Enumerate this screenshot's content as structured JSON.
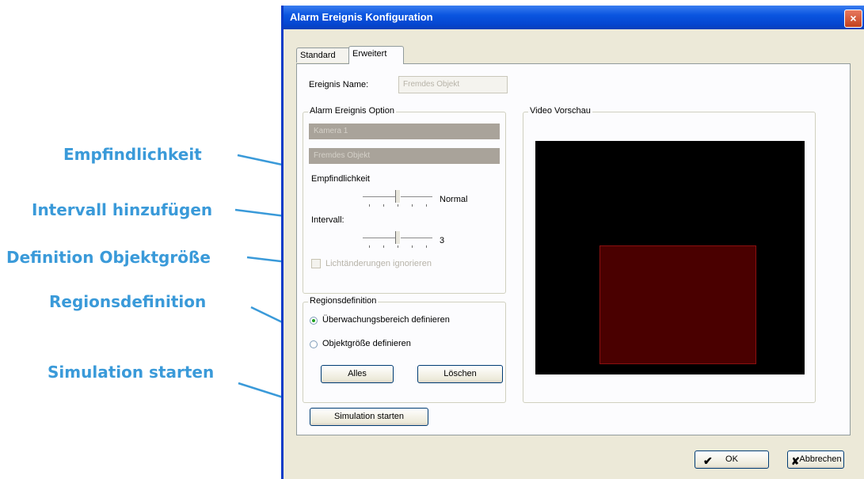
{
  "annotations": {
    "empfindlichkeit": "Empfindlichkeit",
    "intervall": "Intervall hinzufügen",
    "objektgroesse": "Definition Objektgröße",
    "regionsdefinition": "Regionsdefinition",
    "simulation": "Simulation starten",
    "color": "#3a9ad9"
  },
  "window": {
    "title": "Alarm Ereignis Konfiguration",
    "close_label": "×"
  },
  "tabs": [
    {
      "label": "Standard",
      "active": false
    },
    {
      "label": "Erweitert",
      "active": true
    }
  ],
  "event_name": {
    "label": "Ereignis Name:",
    "value": "Fremdes Objekt"
  },
  "alarm_option": {
    "group_label": "Alarm Ereignis Option",
    "camera": "Kamera 1",
    "type": "Fremdes Objekt",
    "sensitivity_label": "Empfindlichkeit",
    "sensitivity_value": "Normal",
    "sensitivity_level": 0.5,
    "interval_label": "Intervall:",
    "interval_value": "3",
    "interval_level": 0.5,
    "ignore_light_label": "Lichtänderungen ignorieren"
  },
  "region": {
    "group_label": "Regionsdefinition",
    "option_monitor": "Überwachungsbereich definieren",
    "option_object": "Objektgröße definieren",
    "all_button": "Alles",
    "delete_button": "Löschen"
  },
  "video": {
    "label": "Video Vorschau"
  },
  "simulate_button": "Simulation starten",
  "ok_button": "OK",
  "cancel_button": "Abbrechen"
}
